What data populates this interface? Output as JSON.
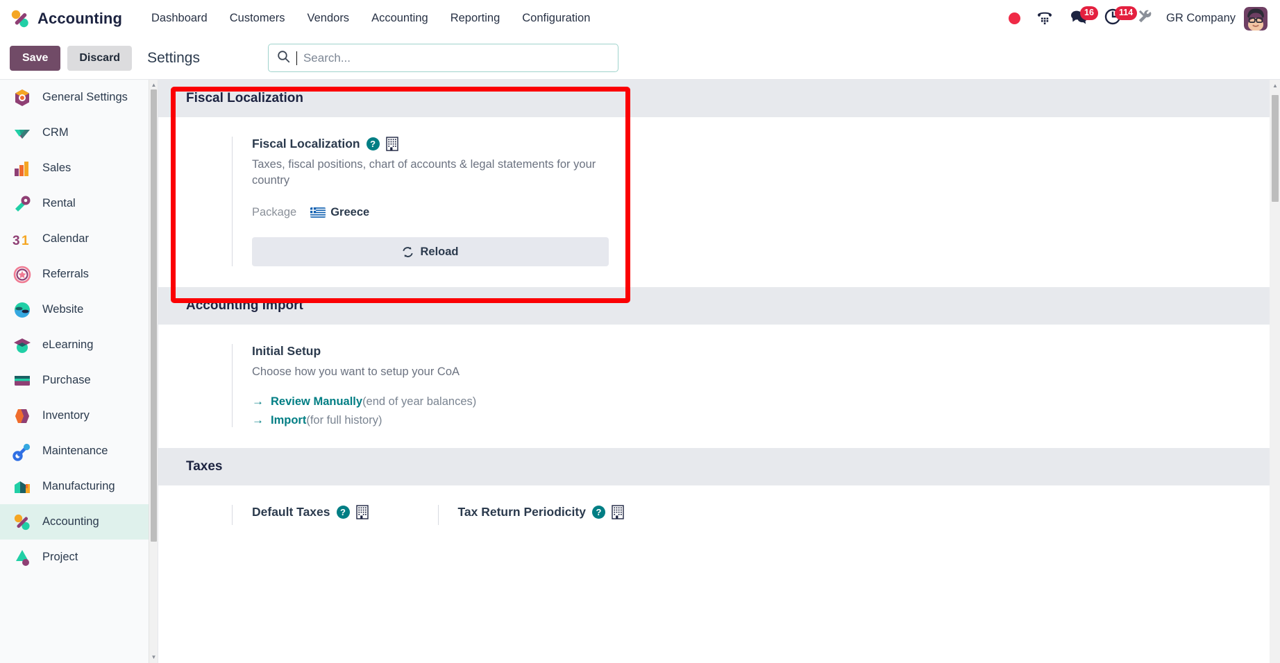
{
  "navbar": {
    "brand": "Accounting",
    "brand_logo_icon": "odoo-accounting-logo-icon",
    "menu": [
      {
        "label": "Dashboard"
      },
      {
        "label": "Customers"
      },
      {
        "label": "Vendors"
      },
      {
        "label": "Accounting"
      },
      {
        "label": "Reporting"
      },
      {
        "label": "Configuration"
      }
    ],
    "status": {
      "recording_icon": "recording-dot-icon",
      "dialpad_icon": "dialpad-icon",
      "messages_icon": "messages-icon",
      "messages_count": "16",
      "activities_icon": "activities-clock-icon",
      "activities_count": "114",
      "tools_icon": "tools-wrench-icon"
    },
    "company": "GR Company",
    "avatar_icon": "user-avatar"
  },
  "control_panel": {
    "save_label": "Save",
    "discard_label": "Discard",
    "title": "Settings",
    "search_placeholder": "Search...",
    "search_value": "",
    "search_icon": "search-icon"
  },
  "sidebar": {
    "items": [
      {
        "label": "General Settings",
        "icon": "settings-app-icon",
        "active": false
      },
      {
        "label": "CRM",
        "icon": "crm-app-icon",
        "active": false
      },
      {
        "label": "Sales",
        "icon": "sales-app-icon",
        "active": false
      },
      {
        "label": "Rental",
        "icon": "rental-app-icon",
        "active": false
      },
      {
        "label": "Calendar",
        "icon": "calendar-app-icon",
        "active": false
      },
      {
        "label": "Referrals",
        "icon": "referrals-app-icon",
        "active": false
      },
      {
        "label": "Website",
        "icon": "website-app-icon",
        "active": false
      },
      {
        "label": "eLearning",
        "icon": "elearning-app-icon",
        "active": false
      },
      {
        "label": "Purchase",
        "icon": "purchase-app-icon",
        "active": false
      },
      {
        "label": "Inventory",
        "icon": "inventory-app-icon",
        "active": false
      },
      {
        "label": "Maintenance",
        "icon": "maintenance-app-icon",
        "active": false
      },
      {
        "label": "Manufacturing",
        "icon": "manufacturing-app-icon",
        "active": false
      },
      {
        "label": "Accounting",
        "icon": "accounting-app-icon",
        "active": true
      },
      {
        "label": "Project",
        "icon": "project-app-icon",
        "active": false
      }
    ]
  },
  "sections": {
    "fiscal_localization": {
      "heading": "Fiscal Localization",
      "setting_title": "Fiscal Localization",
      "help_icon": "help-circle-icon",
      "company_icon": "company-building-icon",
      "description": "Taxes, fiscal positions, chart of accounts & legal statements for your country",
      "package_label": "Package",
      "package_value": "Greece",
      "package_flag_icon": "greece-flag-icon",
      "reload_label": "Reload",
      "reload_icon": "reload-refresh-icon"
    },
    "accounting_import": {
      "heading": "Accounting Import",
      "setting_title": "Initial Setup",
      "description": "Choose how you want to setup your CoA",
      "links": [
        {
          "arrow": "→",
          "label": "Review Manually",
          "note": "(end of year balances)"
        },
        {
          "arrow": "→",
          "label": "Import",
          "note": "(for full history)"
        }
      ]
    },
    "taxes": {
      "heading": "Taxes",
      "left_title": "Default Taxes",
      "left_help_icon": "help-circle-icon",
      "left_company_icon": "company-building-icon",
      "right_title": "Tax Return Periodicity",
      "right_help_icon": "help-circle-icon",
      "right_company_icon": "company-building-icon"
    }
  },
  "highlight": {
    "color": "#fb0104",
    "target": "fiscal-localization-section"
  },
  "colors": {
    "primary_purple": "#714B67",
    "accent_teal": "#017e84",
    "badge_red": "#e4203f",
    "section_header_bg": "#e7e9ed",
    "active_sidebar_bg": "#dff1ec"
  }
}
